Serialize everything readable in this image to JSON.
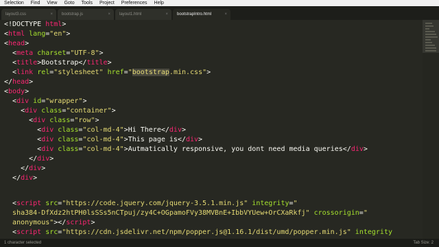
{
  "menu": [
    "Selection",
    "Find",
    "View",
    "Goto",
    "Tools",
    "Project",
    "Preferences",
    "Help"
  ],
  "tabs": [
    {
      "label": "layout3.css"
    },
    {
      "label": "bootstrap.js"
    },
    {
      "label": "layout1.html"
    },
    {
      "label": "bootstrapIntro.html"
    }
  ],
  "active_tab": 3,
  "code": {
    "l1": [
      "<!DOCTYPE",
      "html",
      ">"
    ],
    "l2": [
      "<",
      "html",
      "lang",
      "=",
      "\"en\"",
      ">"
    ],
    "l3": [
      "<",
      "head",
      ">"
    ],
    "l4": [
      "<",
      "meta",
      "charset",
      "=",
      "\"UTF-8\"",
      ">"
    ],
    "l5": [
      "<",
      "title",
      ">",
      "Bootstrap",
      "</",
      "title",
      ">"
    ],
    "l6": [
      "<",
      "link",
      "rel",
      "=",
      "\"stylesheet\"",
      "href",
      "=",
      "\"",
      "bootstrap",
      ".min.css\"",
      ">"
    ],
    "l7": [
      "</",
      "head",
      ">"
    ],
    "l8": [
      "<",
      "body",
      ">"
    ],
    "l9": [
      "<",
      "div",
      "id",
      "=",
      "\"wrapper\"",
      ">"
    ],
    "l10": [
      "<",
      "div",
      "class",
      "=",
      "\"container\"",
      ">"
    ],
    "l11": [
      "<",
      "div",
      "class",
      "=",
      "\"row\"",
      ">"
    ],
    "l12": [
      "<",
      "div",
      "class",
      "=",
      "\"col-md-4\"",
      ">",
      "Hi There",
      "</",
      "div",
      ">"
    ],
    "l13": [
      "<",
      "div",
      "class",
      "=",
      "\"col-md-4\"",
      ">",
      "This page is",
      "</",
      "div",
      ">"
    ],
    "l14": [
      "<",
      "div",
      "class",
      "=",
      "\"col-md-4\"",
      ">",
      "Autmatically responsive, you dont need media queries",
      "</",
      "div",
      ">"
    ],
    "l15": [
      "</",
      "div",
      ">"
    ],
    "l16": [
      "</",
      "div",
      ">"
    ],
    "l17": [
      "</",
      "div",
      ">"
    ],
    "l18": [
      "<",
      "script",
      "src",
      "=",
      "\"https://code.jquery.com/jquery-3.5.1.min.js\"",
      "integrity",
      "=",
      "\""
    ],
    "l19": [
      "sha384-DfXdz2htPH0lsSSs5nCTpuj/zy4C+OGpamoFVy38MVBnE+IbbVYUew+OrCXaRkfj\"",
      "crossorigin",
      "=",
      "\""
    ],
    "l20": [
      "anonymous\"",
      "></",
      "script",
      ">"
    ],
    "l21": [
      "<",
      "script",
      "src",
      "=",
      "\"https://cdn.jsdelivr.net/npm/popper.js@1.16.1/dist/umd/popper.min.js\"",
      "integrity"
    ]
  },
  "status": {
    "left": "1 character selected",
    "right": "Tab Size: 2"
  },
  "colors": {
    "background": "#272822",
    "tag": "#f92672",
    "attribute": "#a6e22e",
    "string": "#e6db74",
    "text": "#f8f8f2"
  }
}
